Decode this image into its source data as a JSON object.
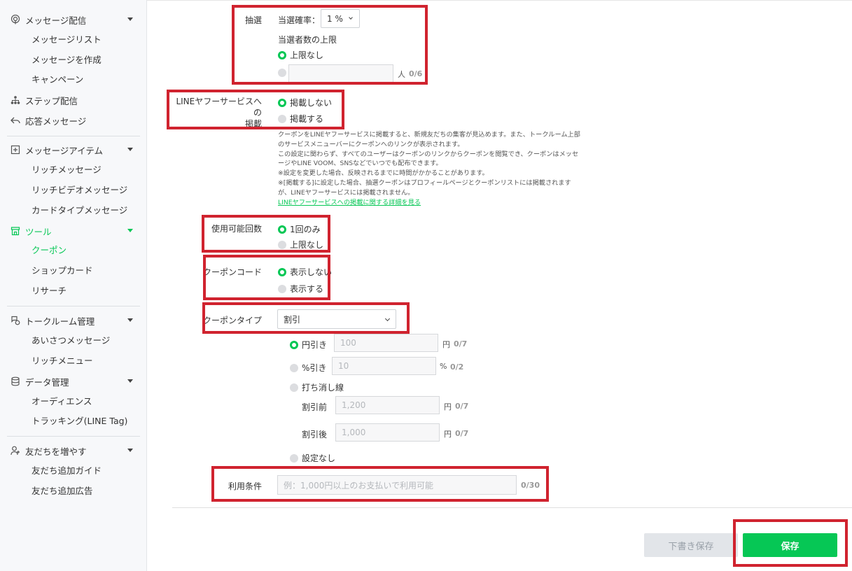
{
  "sidebar": {
    "sections": [
      {
        "label": "メッセージ配信",
        "icon": "broadcast-icon",
        "items": [
          "メッセージリスト",
          "メッセージを作成",
          "キャンペーン"
        ]
      },
      {
        "label": "ステップ配信",
        "icon": "step-icon"
      },
      {
        "label": "応答メッセージ",
        "icon": "reply-icon"
      },
      {
        "label": "メッセージアイテム",
        "icon": "plus-box-icon",
        "items": [
          "リッチメッセージ",
          "リッチビデオメッセージ",
          "カードタイプメッセージ"
        ]
      },
      {
        "label": "ツール",
        "icon": "store-icon",
        "active": true,
        "items": [
          "クーポン",
          "ショップカード",
          "リサーチ"
        ]
      },
      {
        "label": "トークルーム管理",
        "icon": "chat-settings-icon",
        "items": [
          "あいさつメッセージ",
          "リッチメニュー"
        ]
      },
      {
        "label": "データ管理",
        "icon": "database-icon",
        "items": [
          "オーディエンス",
          "トラッキング(LINE Tag)"
        ]
      },
      {
        "label": "友だちを増やす",
        "icon": "add-friend-icon",
        "items": [
          "友だち追加ガイド",
          "友だち追加広告"
        ]
      }
    ],
    "active_item": "クーポン"
  },
  "lottery": {
    "label": "抽選",
    "rate_label": "当選確率：",
    "rate_value": "1 %",
    "limit_label": "当選者数の上限",
    "option_unlimited": "上限なし",
    "unit": "人",
    "count": "0/6"
  },
  "listing": {
    "label_line1": "LINEヤフーサービスへの",
    "label_line2": "掲載",
    "option_no": "掲載しない",
    "option_yes": "掲載する",
    "description": [
      "クーポンをLINEヤフーサービスに掲載すると、新規友だちの集客が見込めます。また、トークルーム上部",
      "のサービスメニューバーにクーポンへのリンクが表示されます。",
      "この設定に関わらず、すべてのユーザーはクーポンのリンクからクーポンを閲覧でき、クーポンはメッセ",
      "ージやLINE VOOM、SNSなどでいつでも配布できます。",
      "※設定を変更した場合、反映されるまでに時間がかかることがあります。",
      "※[掲載する]に設定した場合、抽選クーポンはプロフィールページとクーポンリストには掲載されます",
      "が、LINEヤフーサービスには掲載されません。"
    ],
    "link": "LINEヤフーサービスへの掲載に関する詳細を見る"
  },
  "usage_count": {
    "label": "使用可能回数",
    "option_once": "1回のみ",
    "option_unlimited": "上限なし"
  },
  "coupon_code": {
    "label": "クーポンコード",
    "option_hide": "表示しない",
    "option_show": "表示する"
  },
  "coupon_type": {
    "label": "クーポンタイプ",
    "selected": "割引",
    "yen_off": {
      "label": "円引き",
      "placeholder": "100",
      "unit": "円",
      "count": "0/7"
    },
    "percent_off": {
      "label": "%引き",
      "placeholder": "10",
      "unit": "%",
      "count": "0/2"
    },
    "strikethrough": {
      "label": "打ち消し線"
    },
    "before": {
      "label": "割引前",
      "placeholder": "1,200",
      "unit": "円",
      "count": "0/7"
    },
    "after": {
      "label": "割引後",
      "placeholder": "1,000",
      "unit": "円",
      "count": "0/7"
    },
    "none": {
      "label": "設定なし"
    }
  },
  "terms": {
    "label": "利用条件",
    "placeholder": "例：1,000円以上のお支払いで利用可能",
    "count": "0/30"
  },
  "actions": {
    "draft": "下書き保存",
    "save": "保存"
  },
  "colors": {
    "accent": "#06c755",
    "highlight": "#d0232f"
  }
}
